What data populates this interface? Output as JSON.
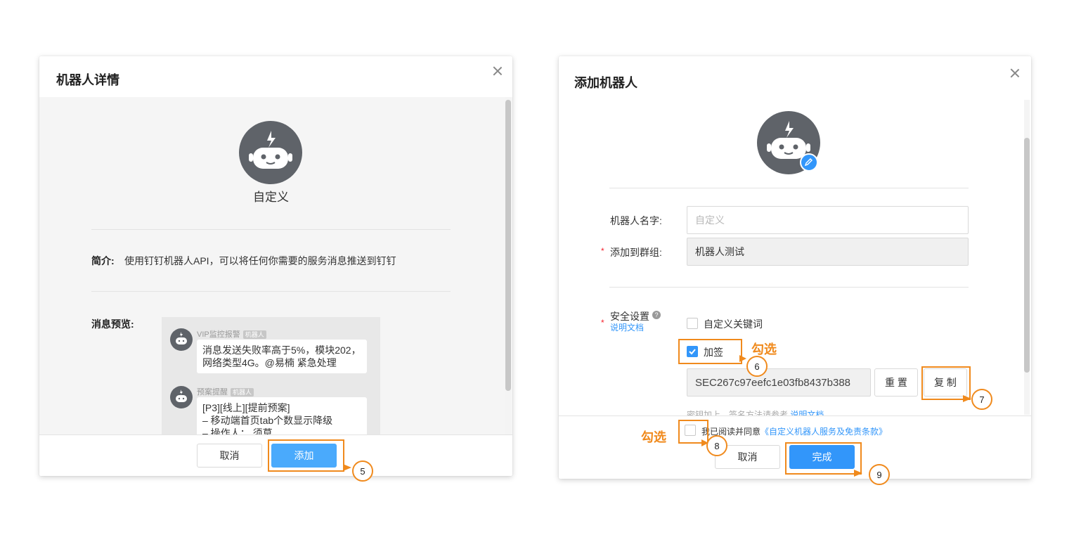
{
  "left_dialog": {
    "title": "机器人详情",
    "robot_name": "自定义",
    "intro_label": "简介:",
    "intro_text": "使用钉钉机器人API，可以将任何你需要的服务消息推送到钉钉",
    "preview_label": "消息预览:",
    "messages": [
      {
        "sender": "VIP监控报警",
        "tag": "机器人",
        "lines": [
          "消息发送失败率高于5%，模块202，",
          "网络类型4G。@易楠 紧急处理"
        ]
      },
      {
        "sender": "预案提醒",
        "tag": "机器人",
        "lines": [
          "[P3][线上][提前预案]",
          "– 移动端首页tab个数显示降级",
          "– 操作人： 须草"
        ]
      }
    ],
    "cancel_label": "取消",
    "add_label": "添加",
    "step": "5"
  },
  "right_dialog": {
    "title": "添加机器人",
    "name_label": "机器人名字:",
    "name_placeholder": "自定义",
    "group_label": "添加到群组:",
    "group_value": "机器人测试",
    "security_label": "安全设置",
    "doc_link": "说明文档",
    "keyword_label": "自定义关键词",
    "sign_label": "加签",
    "secret_value": "SEC267c97eefc1e03fb8437b388",
    "reset_label": "重 置",
    "copy_label": "复 制",
    "hint_text": "密钥加上，签名方法请参考",
    "hint_link": "说明文档",
    "agree_text": "我已阅读并同意",
    "agree_link": "《自定义机器人服务及免责条款》",
    "cancel_label": "取消",
    "finish_label": "完成",
    "check_note": "勾选",
    "steps": [
      "6",
      "7",
      "8",
      "9"
    ]
  },
  "colors": {
    "accent": "#3296fa",
    "annotation": "#f08a1d",
    "avatar": "#5f6369"
  }
}
